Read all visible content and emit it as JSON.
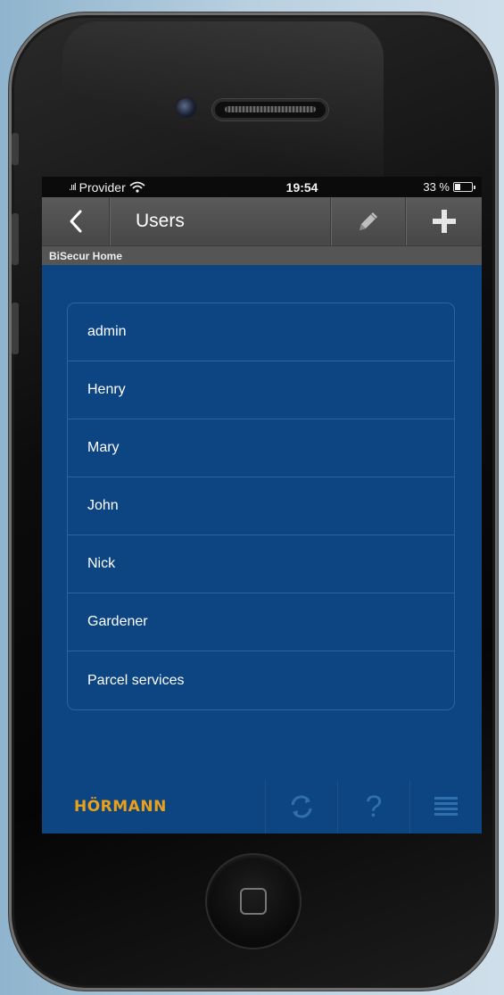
{
  "status_bar": {
    "signal": ".ııl",
    "carrier": "Provider",
    "time": "19:54",
    "battery_percent": "33 %"
  },
  "nav": {
    "title": "Users",
    "back_icon": "chevron-left-icon",
    "edit_icon": "pencil-icon",
    "add_icon": "plus-icon"
  },
  "location": "BiSecur Home",
  "users": [
    {
      "name": "admin"
    },
    {
      "name": "Henry"
    },
    {
      "name": "Mary"
    },
    {
      "name": "John"
    },
    {
      "name": "Nick"
    },
    {
      "name": "Gardener"
    },
    {
      "name": "Parcel services"
    }
  ],
  "footer": {
    "brand": "HÖRMANN",
    "sync_icon": "sync-icon",
    "help_label": "?",
    "menu_icon": "hamburger-menu-icon"
  },
  "colors": {
    "screen_background": "#0c4582",
    "brand": "#e9a01a",
    "nav_bar": "#4f4f4f"
  }
}
